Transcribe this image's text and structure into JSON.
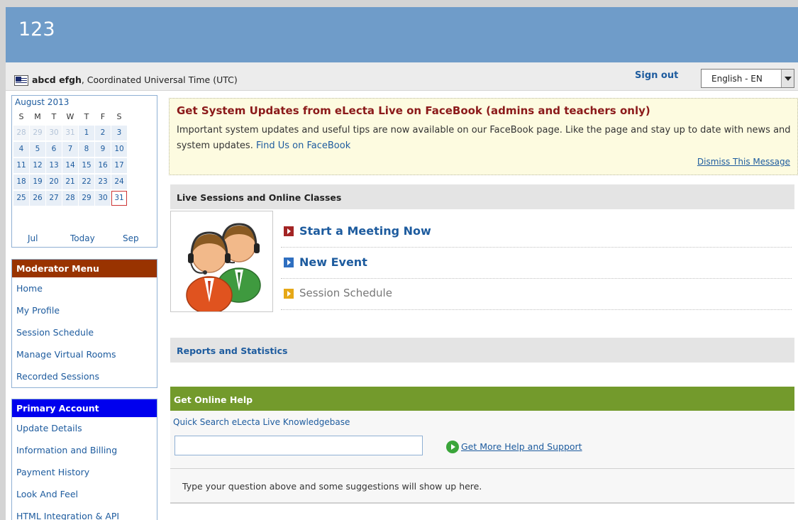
{
  "app": {
    "title": "123"
  },
  "userbar": {
    "user_name": "abcd efgh",
    "timezone": ", Coordinated Universal Time (UTC)",
    "sign_out": "Sign out",
    "language": "English - EN"
  },
  "calendar": {
    "month": "August 2013",
    "weekdays": [
      "S",
      "M",
      "T",
      "W",
      "T",
      "F",
      "S"
    ],
    "weeks": [
      [
        "28",
        "29",
        "30",
        "31",
        "1",
        "2",
        "3"
      ],
      [
        "4",
        "5",
        "6",
        "7",
        "8",
        "9",
        "10"
      ],
      [
        "11",
        "12",
        "13",
        "14",
        "15",
        "16",
        "17"
      ],
      [
        "18",
        "19",
        "20",
        "21",
        "22",
        "23",
        "24"
      ],
      [
        "25",
        "26",
        "27",
        "28",
        "29",
        "30",
        "31"
      ]
    ],
    "prev": "Jul",
    "today": "Today",
    "next": "Sep"
  },
  "moderator_menu": {
    "title": "Moderator Menu",
    "items": [
      "Home",
      "My Profile",
      "Session Schedule",
      "Manage Virtual Rooms",
      "Recorded Sessions"
    ]
  },
  "primary_account": {
    "title": "Primary Account",
    "items": [
      "Update Details",
      "Information and Billing",
      "Payment History",
      "Look And Feel",
      "HTML Integration & API"
    ]
  },
  "notice": {
    "title": "Get System Updates from eLecta Live on FaceBook (admins and teachers only)",
    "text": "Important system updates and useful tips are now available on our FaceBook page. Like the page and stay up to date with news and system updates.",
    "link": "Find Us on FaceBook",
    "dismiss": "Dismiss This Message"
  },
  "live_sessions": {
    "title": "Live Sessions and Online Classes",
    "start_meeting": "Start a Meeting Now",
    "new_event": "New Event",
    "session_schedule": "Session Schedule"
  },
  "reports": {
    "title": "Reports and Statistics"
  },
  "help": {
    "title": "Get Online Help",
    "quick_search": "Quick Search eLecta Live Knowledgebase",
    "search_value": "",
    "more_help": "Get More Help and Support",
    "hint": "Type your question above and some suggestions will show up here."
  },
  "colors": {
    "header_blue": "#6f9cc9",
    "moderator_head": "#993300",
    "primary_head": "#0000ee",
    "help_green": "#739a2c",
    "notice_title": "#8b1a1a",
    "start_icon": "#a32424",
    "new_event_icon": "#2f6fc0",
    "schedule_icon": "#e6a817"
  }
}
